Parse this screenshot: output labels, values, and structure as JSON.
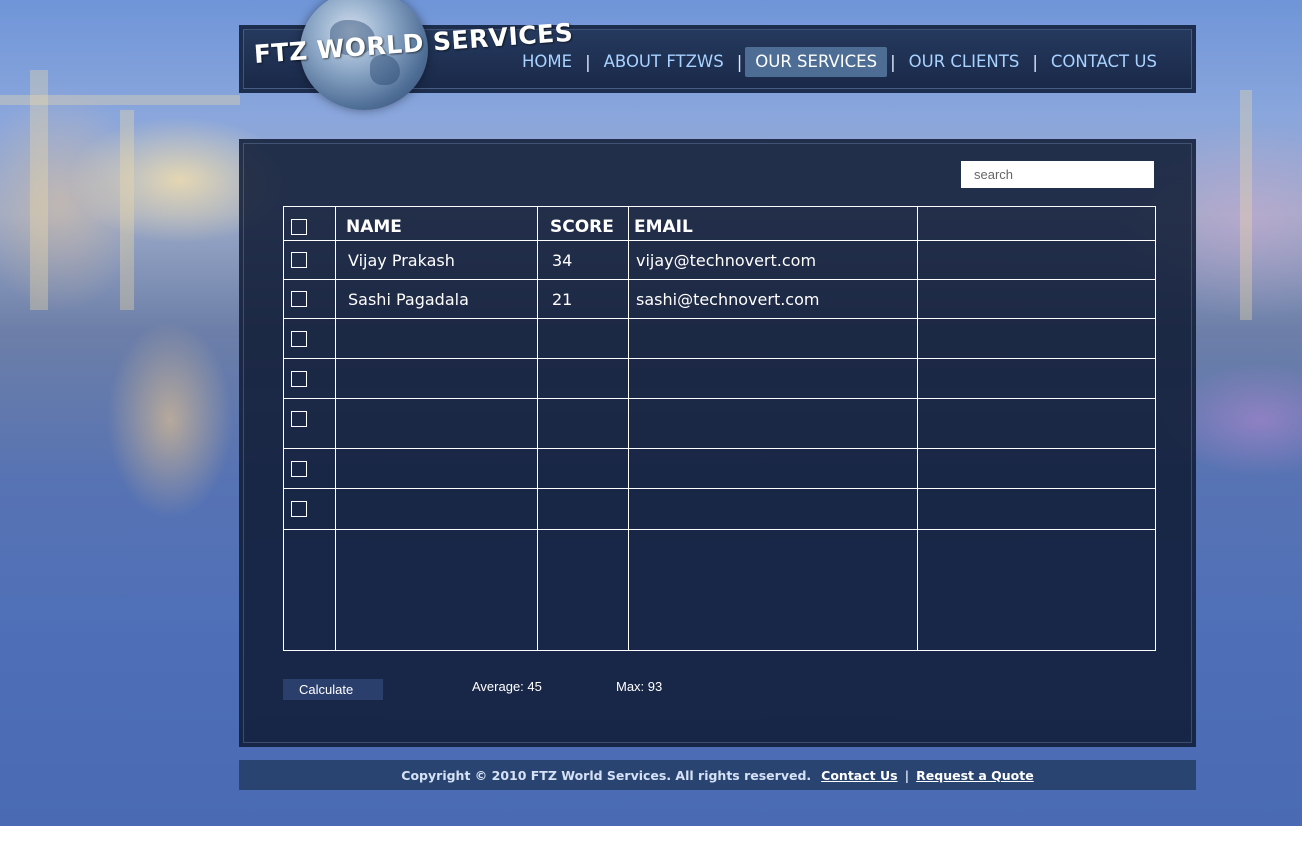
{
  "brand": {
    "logo_text": "FTZ WORLD SERVICES"
  },
  "nav": {
    "items": [
      {
        "label": "HOME",
        "active": false
      },
      {
        "label": "ABOUT FTZWS",
        "active": false
      },
      {
        "label": "OUR SERVICES",
        "active": true
      },
      {
        "label": "OUR CLIENTS",
        "active": false
      },
      {
        "label": "CONTACT US",
        "active": false
      }
    ],
    "separator": "|"
  },
  "search": {
    "placeholder": "search",
    "value": ""
  },
  "table": {
    "headers": [
      "NAME",
      "SCORE",
      "EMAIL",
      ""
    ],
    "rows": [
      {
        "name": "Vijay Prakash",
        "score": "34",
        "email": "vijay@technovert.com",
        "extra": ""
      },
      {
        "name": "Sashi Pagadala",
        "score": "21",
        "email": "sashi@technovert.com",
        "extra": ""
      },
      {
        "name": "",
        "score": "",
        "email": "",
        "extra": ""
      },
      {
        "name": "",
        "score": "",
        "email": "",
        "extra": ""
      },
      {
        "name": "",
        "score": "",
        "email": "",
        "extra": ""
      },
      {
        "name": "",
        "score": "",
        "email": "",
        "extra": ""
      },
      {
        "name": "",
        "score": "",
        "email": "",
        "extra": ""
      }
    ]
  },
  "actions": {
    "calculate_label": "Calculate"
  },
  "stats": {
    "average": "Average: 45",
    "max": "Max: 93"
  },
  "footer": {
    "copyright": "Copyright © 2010  FTZ World Services. All rights reserved.",
    "contact_link": "Contact Us",
    "separator": "|",
    "quote_link": "Request a Quote"
  },
  "colors": {
    "header_bg": "#1d2d4d",
    "nav_text": "#a8d2ff",
    "nav_active_bg": "#4d6d95",
    "panel_bg": "#0f1b34",
    "button_bg": "#2b3f6d",
    "footer_bg": "#2a4472"
  }
}
